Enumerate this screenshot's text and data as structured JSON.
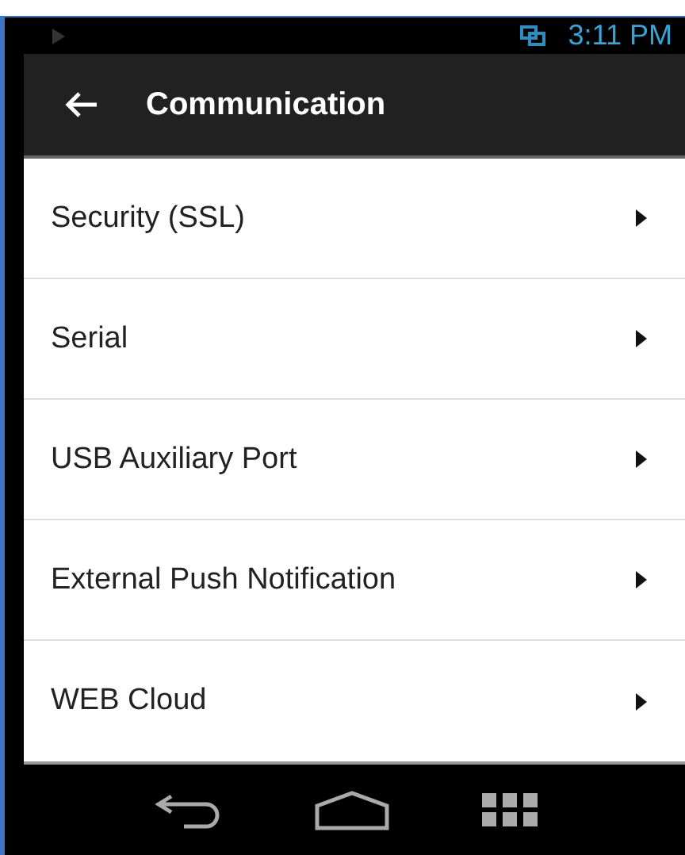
{
  "status_bar": {
    "time": "3:11 PM"
  },
  "app_bar": {
    "title": "Communication"
  },
  "menu_items": [
    {
      "label": "Security (SSL)"
    },
    {
      "label": "Serial"
    },
    {
      "label": "USB Auxiliary Port"
    },
    {
      "label": "External Push Notification"
    },
    {
      "label": "WEB Cloud"
    }
  ]
}
